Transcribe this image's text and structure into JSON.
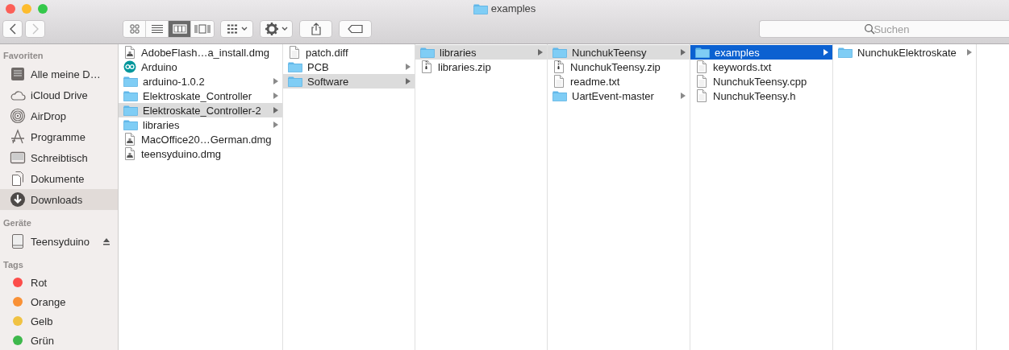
{
  "window": {
    "title": "examples"
  },
  "toolbar": {
    "nav": [
      {
        "kind": "back",
        "disabled": false
      },
      {
        "kind": "forward",
        "disabled": true
      }
    ],
    "view_modes": [
      {
        "kind": "icons",
        "selected": false
      },
      {
        "kind": "list",
        "selected": false
      },
      {
        "kind": "columns",
        "selected": true
      },
      {
        "kind": "coverflow",
        "selected": false
      }
    ],
    "buttons": [
      {
        "kind": "arrange"
      },
      {
        "kind": "action"
      },
      {
        "kind": "share"
      },
      {
        "kind": "tag"
      }
    ]
  },
  "search": {
    "placeholder": "Suchen"
  },
  "sidebar": {
    "sections": [
      {
        "kind": "places",
        "heading": "Favoriten",
        "items": [
          {
            "label": "Alle meine D…",
            "selected": false
          },
          {
            "label": "iCloud Drive",
            "selected": false
          },
          {
            "label": "AirDrop",
            "selected": false
          },
          {
            "label": "Programme",
            "selected": false
          },
          {
            "label": "Schreibtisch",
            "selected": false
          },
          {
            "label": "Dokumente",
            "selected": false
          },
          {
            "label": "Downloads",
            "selected": true
          }
        ]
      },
      {
        "kind": "devices",
        "heading": "Geräte",
        "items": [
          {
            "label": "Teensyduino",
            "selected": false,
            "eject": true
          }
        ]
      },
      {
        "kind": "tags",
        "heading": "Tags",
        "items": [
          {
            "color": "#fc4d4a",
            "label": "Rot",
            "selected": false
          },
          {
            "color": "#f99136",
            "label": "Orange",
            "selected": false
          },
          {
            "color": "#f0c243",
            "label": "Gelb",
            "selected": false
          },
          {
            "color": "#3eb84c",
            "label": "Grün",
            "selected": false
          }
        ]
      }
    ]
  },
  "columns": [
    {
      "items": [
        {
          "kind": "dmg",
          "name": "AdobeFlash…a_install.dmg",
          "selected": false,
          "expanded": false,
          "has_children": false
        },
        {
          "kind": "app",
          "name": "Arduino",
          "selected": false,
          "expanded": false,
          "has_children": false
        },
        {
          "kind": "folder",
          "name": "arduino-1.0.2",
          "selected": false,
          "expanded": false,
          "has_children": true
        },
        {
          "kind": "folder",
          "name": "Elektroskate_Controller",
          "selected": false,
          "expanded": false,
          "has_children": true
        },
        {
          "kind": "folder",
          "name": "Elektroskate_Controller-2",
          "selected": false,
          "expanded": true,
          "has_children": true
        },
        {
          "kind": "folder",
          "name": "libraries",
          "selected": false,
          "expanded": false,
          "has_children": true
        },
        {
          "kind": "dmg",
          "name": "MacOffice20…German.dmg",
          "selected": false,
          "expanded": false,
          "has_children": false
        },
        {
          "kind": "dmg",
          "name": "teensyduino.dmg",
          "selected": false,
          "expanded": false,
          "has_children": false
        }
      ]
    },
    {
      "items": [
        {
          "kind": "file",
          "name": "patch.diff",
          "selected": false,
          "expanded": false,
          "has_children": false
        },
        {
          "kind": "folder",
          "name": "PCB",
          "selected": false,
          "expanded": false,
          "has_children": true
        },
        {
          "kind": "folder",
          "name": "Software",
          "selected": false,
          "expanded": true,
          "has_children": true
        }
      ]
    },
    {
      "items": [
        {
          "kind": "folder",
          "name": "libraries",
          "selected": false,
          "expanded": true,
          "has_children": true
        },
        {
          "kind": "zip",
          "name": "libraries.zip",
          "selected": false,
          "expanded": false,
          "has_children": false
        }
      ]
    },
    {
      "items": [
        {
          "kind": "folder",
          "name": "NunchukTeensy",
          "selected": false,
          "expanded": true,
          "has_children": true
        },
        {
          "kind": "zip",
          "name": "NunchukTeensy.zip",
          "selected": false,
          "expanded": false,
          "has_children": false
        },
        {
          "kind": "file",
          "name": "readme.txt",
          "selected": false,
          "expanded": false,
          "has_children": false
        },
        {
          "kind": "folder",
          "name": "UartEvent-master",
          "selected": false,
          "expanded": false,
          "has_children": true
        }
      ]
    },
    {
      "items": [
        {
          "kind": "folder",
          "name": "examples",
          "selected": true,
          "expanded": true,
          "has_children": true
        },
        {
          "kind": "file",
          "name": "keywords.txt",
          "selected": false,
          "expanded": false,
          "has_children": false
        },
        {
          "kind": "file",
          "name": "NunchukTeensy.cpp",
          "selected": false,
          "expanded": false,
          "has_children": false
        },
        {
          "kind": "file",
          "name": "NunchukTeensy.h",
          "selected": false,
          "expanded": false,
          "has_children": false
        }
      ]
    },
    {
      "items": [
        {
          "kind": "folder",
          "name": "NunchukElektroskate",
          "selected": false,
          "expanded": false,
          "has_children": true
        }
      ]
    }
  ]
}
